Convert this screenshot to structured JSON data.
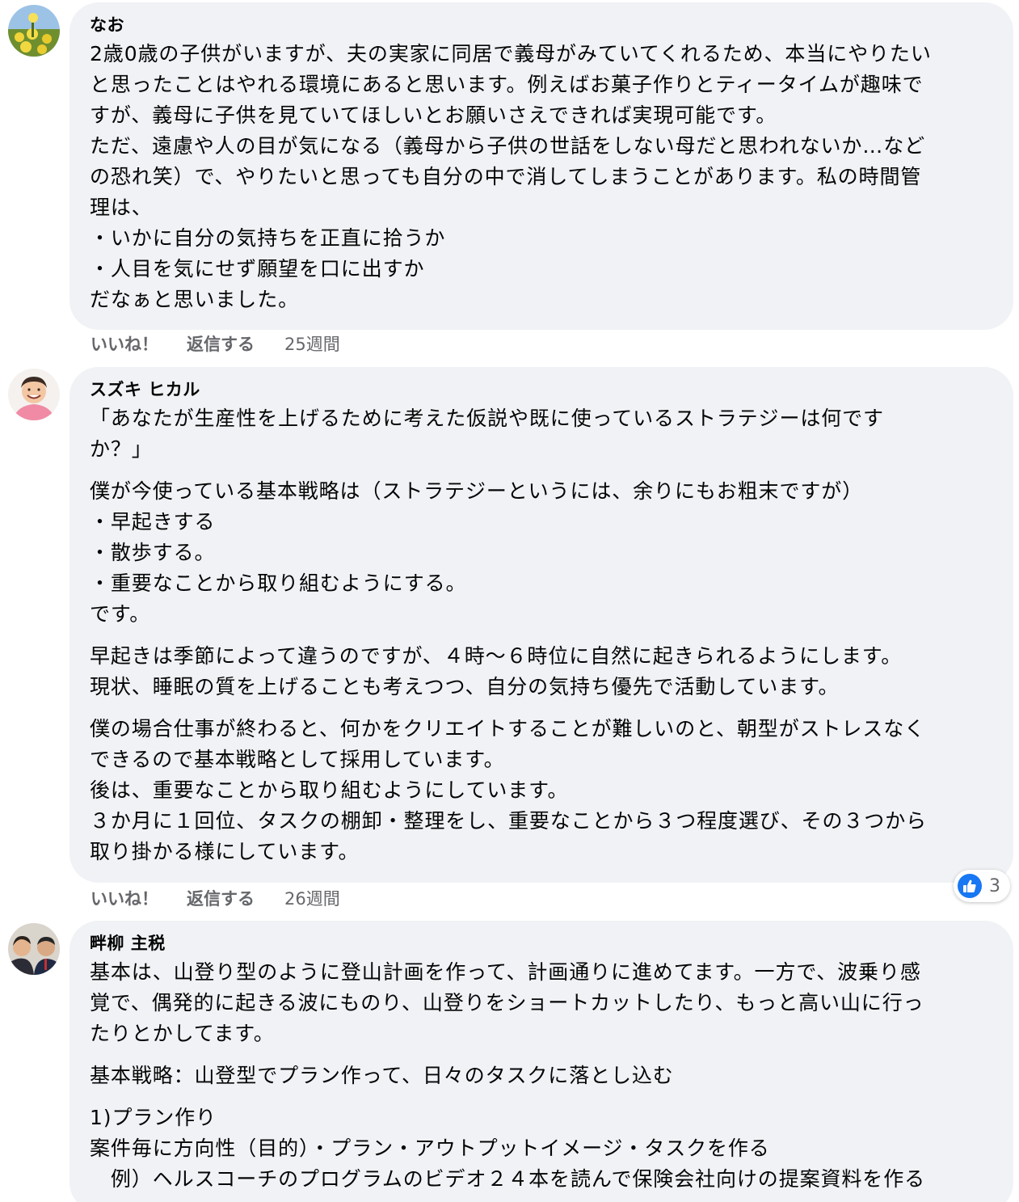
{
  "comments": [
    {
      "author": "なお",
      "avatar_icon": "flower-field-avatar-icon",
      "paragraphs": [
        [
          "2歳0歳の子供がいますが、夫の実家に同居で義母がみていてくれるため、本当にやりたい",
          "と思ったことはやれる環境にあると思います。例えばお菓子作りとティータイムが趣味で",
          "すが、義母に子供を見ていてほしいとお願いさえできれば実現可能です。",
          "ただ、遠慮や人の目が気になる（義母から子供の世話をしない母だと思われないか…など",
          "の恐れ笑）で、やりたいと思っても自分の中で消してしまうことがあります。私の時間管",
          "理は、",
          "・いかに自分の気持ちを正直に拾うか",
          "・人目を気にせず願望を口に出すか",
          "だなぁと思いました。"
        ]
      ],
      "like_label": "いいね！",
      "reply_label": "返信する",
      "time": "25週間"
    },
    {
      "author": "スズキ ヒカル",
      "avatar_icon": "smiling-man-avatar-icon",
      "paragraphs": [
        [
          "「あなたが生産性を上げるために考えた仮説や既に使っているストラテジーは何です",
          "か？」"
        ],
        [
          "僕が今使っている基本戦略は（ストラテジーというには、余りにもお粗末ですが）",
          "・早起きする",
          "・散歩する。",
          "・重要なことから取り組むようにする。",
          "です。"
        ],
        [
          "早起きは季節によって違うのですが、４時〜６時位に自然に起きられるようにします。",
          "現状、睡眠の質を上げることも考えつつ、自分の気持ち優先で活動しています。"
        ],
        [
          "僕の場合仕事が終わると、何かをクリエイトすることが難しいのと、朝型がストレスなく",
          "できるので基本戦略として採用しています。",
          "後は、重要なことから取り組むようにしています。",
          "３か月に１回位、タスクの棚卸・整理をし、重要なことから３つ程度選び、その３つから",
          "取り掛かる様にしています。"
        ]
      ],
      "like_label": "いいね！",
      "reply_label": "返信する",
      "time": "26週間",
      "reaction_count": "3"
    },
    {
      "author": "畔柳 主税",
      "avatar_icon": "two-men-avatar-icon",
      "paragraphs": [
        [
          "基本は、山登り型のように登山計画を作って、計画通りに進めてます。一方で、波乗り感",
          "覚で、偶発的に起きる波にものり、山登りをショートカットしたり、もっと高い山に行っ",
          "たりとかしてます。"
        ],
        [
          "基本戦略：山登型でプラン作って、日々のタスクに落とし込む"
        ],
        [
          "1)プラン作り",
          "案件毎に方向性（目的）・プラン・アウトプットイメージ・タスクを作る",
          "　例）ヘルスコーチのプログラムのビデオ２４本を読んで保険会社向けの提案資料を作る"
        ]
      ]
    }
  ],
  "colors": {
    "bubble": "#f0f2f5",
    "meta_text": "#65676b",
    "like_blue": "#1877f2"
  }
}
